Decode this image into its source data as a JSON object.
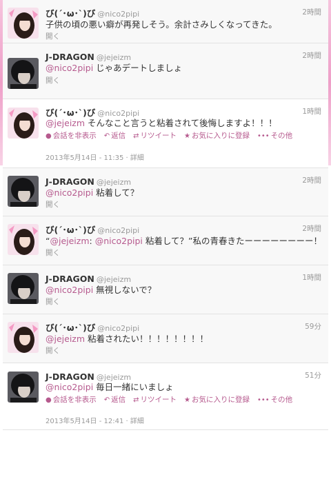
{
  "user_a": {
    "name": "び(´･ω･`)び",
    "handle": "@nico2pipi"
  },
  "user_b": {
    "name": "J-DRAGON",
    "handle": "@jejeizm"
  },
  "open_label": "開く",
  "actions": {
    "hide": "会話を非表示",
    "reply": "返信",
    "retweet": "リツイート",
    "fav": "お気に入りに登録",
    "more": "その他"
  },
  "detail_label": "詳細",
  "tweets": [
    {
      "time": "2時間",
      "segments": [
        {
          "t": "子供の頃の悪い癖が再発しそう。余計さみしくなってきた。",
          "m": false
        }
      ]
    },
    {
      "time": "2時間",
      "segments": [
        {
          "t": "@nico2pipi",
          "m": true
        },
        {
          "t": " じゃあデートしましょ",
          "m": false
        }
      ]
    },
    {
      "time": "1時間",
      "segments": [
        {
          "t": "@jejeizm",
          "m": true
        },
        {
          "t": " そんなこと言うと粘着されて後悔しますよ！！！",
          "m": false
        }
      ],
      "date": "2013年5月14日 - 11:35"
    },
    {
      "time": "2時間",
      "segments": [
        {
          "t": "@nico2pipi",
          "m": true
        },
        {
          "t": " 粘着して？",
          "m": false
        }
      ]
    },
    {
      "time": "2時間",
      "segments": [
        {
          "t": "“",
          "m": false
        },
        {
          "t": "@jejeizm",
          "m": true
        },
        {
          "t": ": ",
          "m": false
        },
        {
          "t": "@nico2pipi",
          "m": true
        },
        {
          "t": " 粘着して？”私の青春きたーーーーーーーー！",
          "m": false
        }
      ]
    },
    {
      "time": "1時間",
      "segments": [
        {
          "t": "@nico2pipi",
          "m": true
        },
        {
          "t": " 無視しないで？",
          "m": false
        }
      ]
    },
    {
      "time": "59分",
      "segments": [
        {
          "t": "@jejeizm",
          "m": true
        },
        {
          "t": " 粘着されたい！！！！！！！！",
          "m": false
        }
      ]
    },
    {
      "time": "51分",
      "segments": [
        {
          "t": "@nico2pipi",
          "m": true
        },
        {
          "t": " 毎日一緒にいましょ",
          "m": false
        }
      ],
      "date": "2013年5月14日 - 12:41"
    }
  ]
}
